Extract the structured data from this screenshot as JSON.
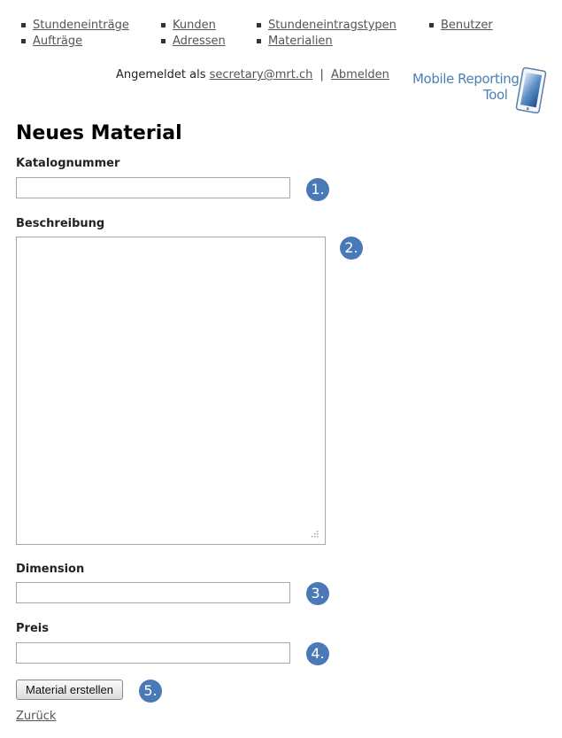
{
  "nav": {
    "columns": [
      [
        "Stundeneinträge",
        "Aufträge"
      ],
      [
        "Kunden",
        "Adressen"
      ],
      [
        "Stundeneintragstypen",
        "Materialien"
      ],
      [
        "Benutzer"
      ]
    ]
  },
  "session": {
    "logged_in_prefix": "Angemeldet als",
    "user_email": "secretary@mrt.ch",
    "separator": "|",
    "logout_label": "Abmelden"
  },
  "logo": {
    "line1": "Mobile Reporting",
    "line2": "Tool"
  },
  "page": {
    "title": "Neues Material"
  },
  "form": {
    "fields": [
      {
        "label": "Katalognummer",
        "value": "",
        "badge": "1."
      },
      {
        "label": "Beschreibung",
        "value": "",
        "badge": "2."
      },
      {
        "label": "Dimension",
        "value": "",
        "badge": "3."
      },
      {
        "label": "Preis",
        "value": "",
        "badge": "4."
      }
    ],
    "submit_label": "Material erstellen",
    "submit_badge": "5.",
    "back_label": "Zurück"
  },
  "colors": {
    "badge": "#4a79b8",
    "logo": "#4a7fb5",
    "link": "#555555"
  }
}
